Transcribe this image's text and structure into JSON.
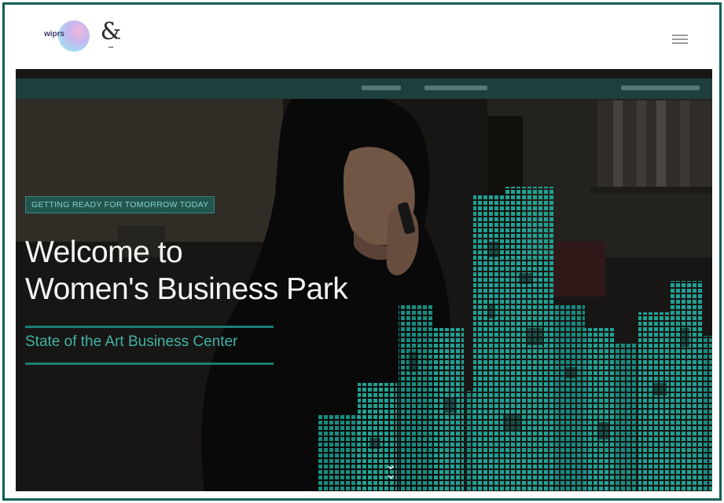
{
  "header": {
    "logo_primary": {
      "text": "wiprs",
      "icon": "gradient-circle-logo"
    },
    "logo_secondary": {
      "icon": "ampersand-logo"
    },
    "menu_icon": "hamburger-menu-icon"
  },
  "hero": {
    "tagline": "GETTING READY FOR TOMORROW TODAY",
    "headline_line1": "Welcome to",
    "headline_line2": "Women's Business Park",
    "subheadline": "State of the Art Business Center",
    "scroll_icon": "double-chevron-down-icon"
  },
  "colors": {
    "frame_border": "#0f5e5a",
    "accent_teal": "#1a7f77",
    "subheadline_teal": "#3fb3a5",
    "nav_strip": "#1f3f3c",
    "building_teal": "#1a9a8d"
  }
}
